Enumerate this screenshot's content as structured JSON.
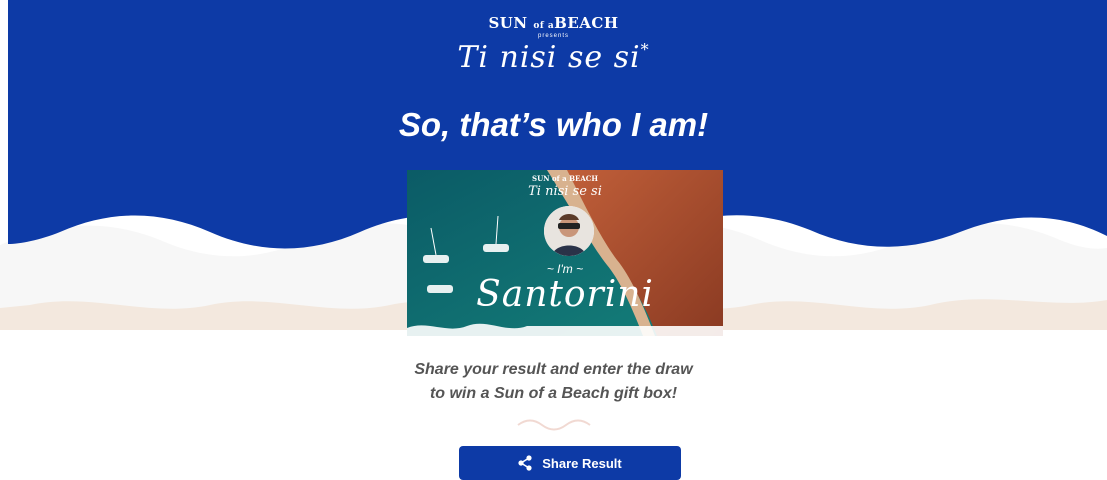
{
  "header": {
    "brand": "SUN",
    "brand_of": "of a",
    "brand_beach": "BEACH",
    "presents": "presents",
    "script_title": "Ti nisi se si",
    "star": "*"
  },
  "result": {
    "title": "So, that’s who I am!",
    "card_brand": "SUN of a BEACH",
    "card_script": "Ti nisi se si",
    "im_label": "~ I'm ~",
    "destination": "Santorini"
  },
  "share": {
    "message_line1": "Share your result and enter the draw",
    "message_line2": "to win a Sun of a Beach gift box!",
    "button_label": "Share Result",
    "icon": "share-icon"
  },
  "colors": {
    "primary_blue": "#0d3aa6",
    "sand": "#f3e8de",
    "text_gray": "#555555"
  }
}
